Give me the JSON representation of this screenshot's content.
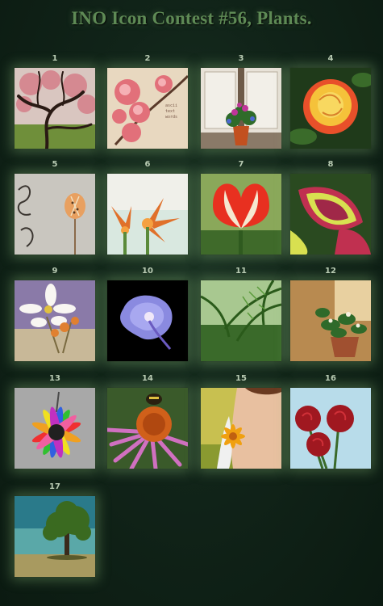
{
  "title": "INO Icon Contest #56, Plants.",
  "icons": [
    {
      "number": "1",
      "name": "blossom-tree-icon"
    },
    {
      "number": "2",
      "name": "pink-blossom-icon"
    },
    {
      "number": "3",
      "name": "potted-flowers-icon"
    },
    {
      "number": "4",
      "name": "yellow-rose-icon"
    },
    {
      "number": "5",
      "name": "seed-pod-icon"
    },
    {
      "number": "6",
      "name": "orange-succulent-flower-icon"
    },
    {
      "number": "7",
      "name": "red-tulip-icon"
    },
    {
      "number": "8",
      "name": "variegated-leaves-icon"
    },
    {
      "number": "9",
      "name": "white-blossom-icon"
    },
    {
      "number": "10",
      "name": "morning-glory-icon"
    },
    {
      "number": "11",
      "name": "palm-fronds-icon"
    },
    {
      "number": "12",
      "name": "potted-plant-icon"
    },
    {
      "number": "13",
      "name": "rainbow-daisy-icon"
    },
    {
      "number": "14",
      "name": "coneflower-bee-icon"
    },
    {
      "number": "15",
      "name": "girl-with-flower-icon"
    },
    {
      "number": "16",
      "name": "red-roses-icon"
    },
    {
      "number": "17",
      "name": "lone-tree-icon"
    }
  ]
}
